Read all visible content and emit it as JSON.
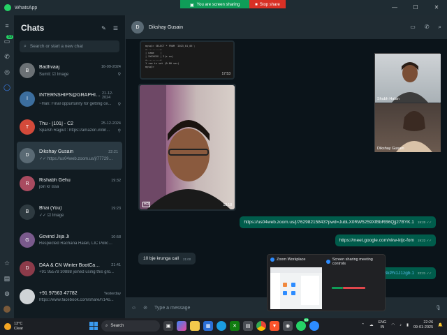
{
  "window": {
    "title": "WhatsApp"
  },
  "share_bar": {
    "status": "You are screen sharing",
    "stop_label": "Stop share"
  },
  "rail": {
    "chats_badge": "53"
  },
  "chatlist": {
    "title": "Chats",
    "search_placeholder": "Search or start a new chat",
    "chats": [
      {
        "name": "Badhvaaj",
        "time": "16-09-2024",
        "preview": "Sumit: ☑ Image",
        "avatar_color": "#6b7175",
        "initial": "B",
        "pinned": true
      },
      {
        "name": "INTERNSHIPS@GRAPHIC E...",
        "time": "21-12-2024",
        "preview": "~Hari: Final oppurtunity for getting ce...",
        "avatar_color": "#3c6e9e",
        "initial": "I",
        "pinned": true
      },
      {
        "name": "Thu - [101] - C2",
        "time": "25-12-2024",
        "preview": "Sparsh Rajput : https://amazon.in/lin...",
        "avatar_color": "#d34a3a",
        "initial": "T",
        "pinned": true
      },
      {
        "name": "Dikshay Gusain",
        "time": "22:21",
        "preview": "✓✓ https://us04web.zoom.us/j/7772948...",
        "avatar_color": "#5a6a74",
        "initial": "D",
        "pinned": false
      },
      {
        "name": "Rishabh Gehu",
        "time": "19:32",
        "preview": "join kr issa",
        "avatar_color": "#a94b60",
        "initial": "R",
        "pinned": false
      },
      {
        "name": "Bhai (You)",
        "time": "19:23",
        "preview": "✓✓ ☑ Image",
        "avatar_color": "#2e3a40",
        "initial": "B",
        "pinned": false
      },
      {
        "name": "Govind Jiija Ji",
        "time": "10:58",
        "preview": "Respected Rachana Halan, LIC Policy 24...",
        "avatar_color": "#7a5a8c",
        "initial": "G",
        "pinned": false
      },
      {
        "name": "DAA & CN Winter BootCamp 5th...",
        "time": "21:41",
        "preview": "+91 95578 30888 joined using this gro...",
        "avatar_color": "#8c3b4a",
        "initial": "D",
        "pinned": false
      },
      {
        "name": "+91 97563 47782",
        "time": "Yesterday",
        "preview": "https://www.facebook.com/share/r/14o...",
        "avatar_color": "#cfd3d6",
        "initial": "",
        "pinned": false
      }
    ]
  },
  "conversation": {
    "contact_name": "Dikshay Gusain",
    "image_top_time": "17:53",
    "code_lines": [
      "mysql> SELECT * FROM `2023_01_05`;",
      "+---------+",
      "| name    |",
      "| XXXXXXX | 2(x xx)",
      "+---------+",
      "1 row in set (0.00 sec)",
      "mysql>"
    ],
    "photo_time": "18:18",
    "incoming": {
      "text": "10 bje krunga call",
      "time": "21:00"
    },
    "outgoing": [
      {
        "text": "https://us04web.zoom.us/j/76298215843?pwd=JubLX0RW5259XfBbRB6Qjj27BYK.1",
        "time": "19:20"
      },
      {
        "text": "https://meet.google.com/vkw-ktjc-fom",
        "time": "19:22"
      },
      {
        "text": "wkBdHPfBkPN1J1zgb.1",
        "time": "22:21"
      }
    ],
    "composer_placeholder": "Type a message"
  },
  "video": {
    "tile1": "Shubh Halan",
    "tile2": "Dikshay Gusain"
  },
  "popup": {
    "left_title": "Zoom Workplace",
    "right_title": "Screen sharing meeting controls"
  },
  "taskbar": {
    "temp": "13°C",
    "condition": "Clear",
    "search_label": "Search",
    "lang": "ENG",
    "region": "IN",
    "time": "22:26",
    "date": "09-01-2025",
    "whatsapp_badge": "53"
  }
}
